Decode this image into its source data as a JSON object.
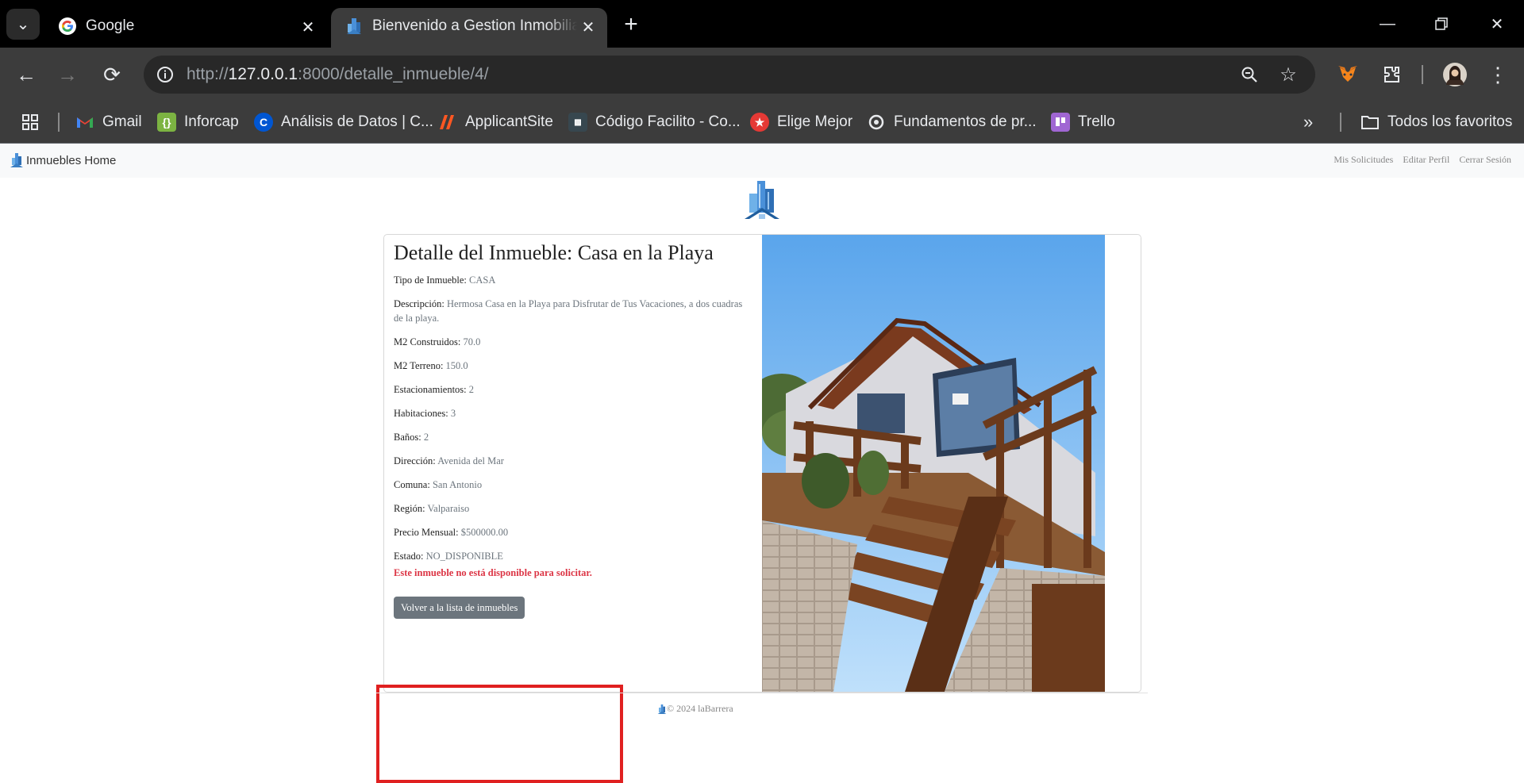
{
  "browser": {
    "tabs": [
      {
        "title": "Google",
        "active": false,
        "favicon": "google-icon"
      },
      {
        "title": "Bienvenido a Gestion Inmobiliaria",
        "active": true,
        "favicon": "building-icon"
      }
    ],
    "url": {
      "scheme": "http://",
      "host": "127.0.0.1",
      "rest": ":8000/detalle_inmueble/4/"
    },
    "bookmarks": [
      {
        "label": "Gmail",
        "icon": "gmail-icon",
        "color": "#ea4335"
      },
      {
        "label": "Inforcap",
        "icon": "inforcap-icon",
        "color": "#7cb342"
      },
      {
        "label": "Análisis de Datos | C...",
        "icon": "coursera-icon",
        "color": "#0056d2"
      },
      {
        "label": "ApplicantSite",
        "icon": "applicantsite-icon",
        "color": "#ff5722"
      },
      {
        "label": "Código Facilito - Co...",
        "icon": "codigofacilito-icon",
        "color": "#37474f"
      },
      {
        "label": "Elige Mejor",
        "icon": "eligemejor-icon",
        "color": "#e53935"
      },
      {
        "label": "Fundamentos de pr...",
        "icon": "fundamentos-icon",
        "color": "#9e9e9e"
      },
      {
        "label": "Trello",
        "icon": "trello-icon",
        "color": "#a066d3"
      }
    ],
    "all_bookmarks_label": "Todos los favoritos"
  },
  "site": {
    "brand": "Inmuebles Home",
    "nav_links": [
      "Mis Solicitudes",
      "Editar Perfil",
      "Cerrar Sesión"
    ],
    "footer": "© 2024 laBarrera"
  },
  "detail": {
    "title": "Detalle del Inmueble: Casa en la Playa",
    "fields": [
      {
        "label": "Tipo de Inmueble:",
        "value": "CASA"
      },
      {
        "label": "Descripción:",
        "value": "Hermosa Casa en la Playa para Disfrutar de Tus Vacaciones, a dos cuadras de la playa."
      },
      {
        "label": "M2 Construidos:",
        "value": "70.0"
      },
      {
        "label": "M2 Terreno:",
        "value": "150.0"
      },
      {
        "label": "Estacionamientos:",
        "value": "2"
      },
      {
        "label": "Habitaciones:",
        "value": "3"
      },
      {
        "label": "Baños:",
        "value": "2"
      },
      {
        "label": "Dirección:",
        "value": "Avenida del Mar"
      },
      {
        "label": "Comuna:",
        "value": "San Antonio"
      },
      {
        "label": "Región:",
        "value": "Valparaiso"
      },
      {
        "label": "Precio Mensual:",
        "value": "$500000.00"
      },
      {
        "label": "Estado:",
        "value": "NO_DISPONIBLE"
      }
    ],
    "unavailable_msg": "Este inmueble no está disponible para solicitar.",
    "back_button": "Volver a la lista de inmuebles"
  },
  "colors": {
    "highlight": "#e02020",
    "danger": "#dc3545",
    "secondary": "#6c757d"
  }
}
